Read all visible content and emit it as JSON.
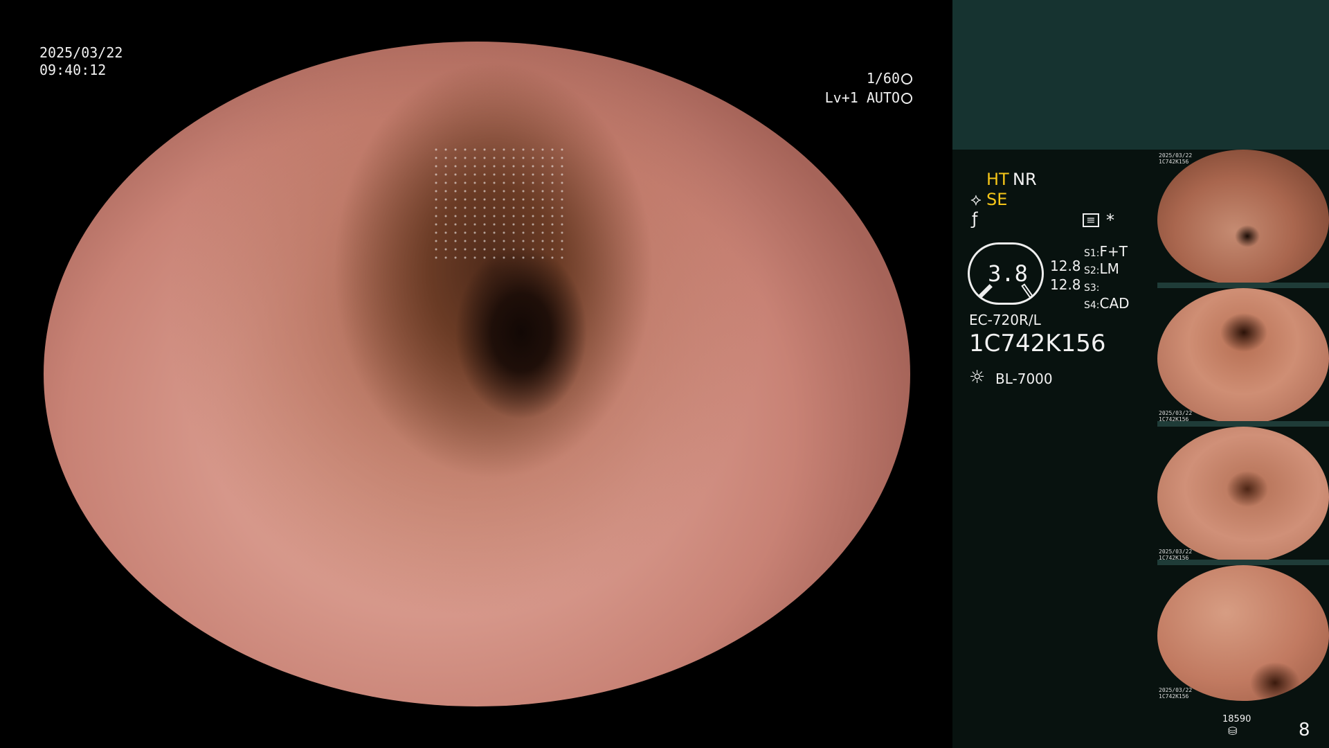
{
  "overlay": {
    "date": "2025/03/22",
    "time": "09:40:12",
    "shutter": "1/60",
    "exposure": "Lv+1 AUTO"
  },
  "panel": {
    "tags": {
      "ht": "HT",
      "nr": "NR",
      "se": "SE",
      "asterisk": "*"
    },
    "gauge_value": "3.8",
    "side_values": [
      "12.8",
      "12.8"
    ],
    "presets": [
      {
        "slot": "S1:",
        "value": "F+T"
      },
      {
        "slot": "S2:",
        "value": "LM"
      },
      {
        "slot": "S3:",
        "value": ""
      },
      {
        "slot": "S4:",
        "value": "CAD"
      }
    ],
    "scope_model": "EC-720R/L",
    "serial": "1C742K156",
    "light_source": "BL-7000",
    "storage_count": "18590",
    "page_number": "8"
  },
  "thumbnails": [
    {
      "mini_date": "2025/03/22",
      "mini_id": "1C742K156"
    },
    {
      "mini_date": "2025/03/22",
      "mini_id": "1C742K156"
    },
    {
      "mini_date": "2025/03/22",
      "mini_id": "1C742K156"
    },
    {
      "mini_date": "2025/03/22",
      "mini_id": "1C742K156"
    }
  ],
  "colors": {
    "panel_bg": "#08120f",
    "panel_top": "#163330",
    "accent_yellow": "#f5c518",
    "mucosa": "#d6978a"
  },
  "icons": [
    "lightsource-icon",
    "shutter-icon",
    "auto-icon",
    "pump-icon",
    "enhance-icon",
    "settings-icon",
    "storage-icon"
  ]
}
